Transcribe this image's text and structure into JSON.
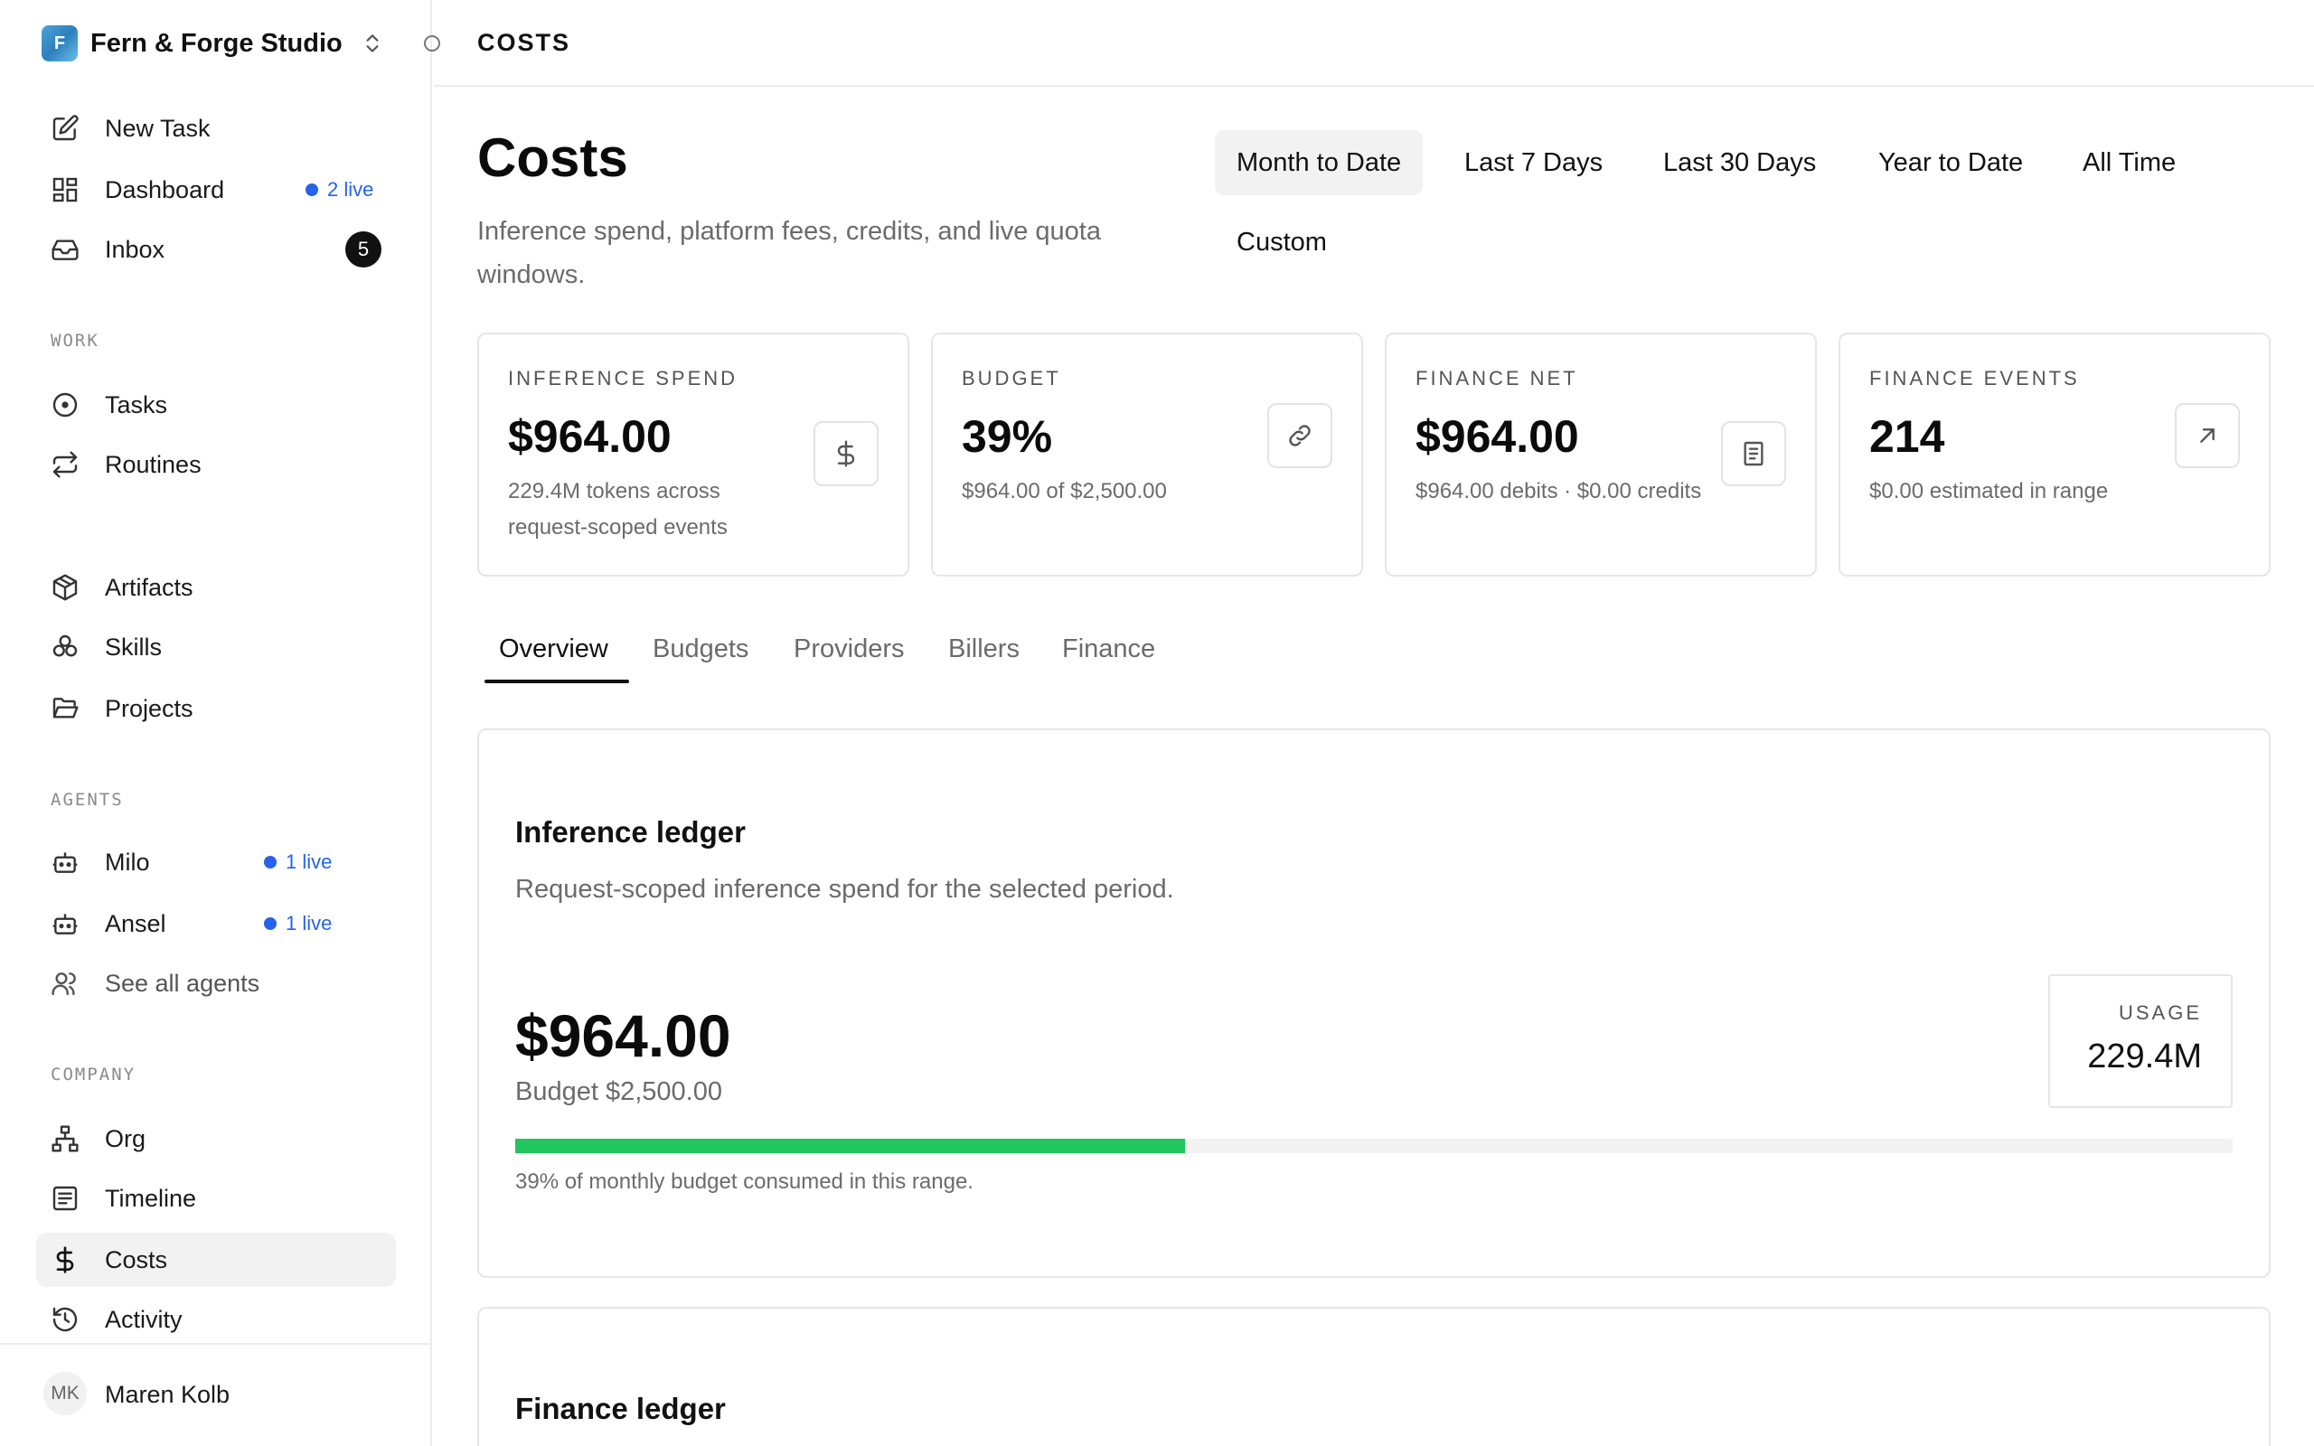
{
  "sidebar": {
    "company_name": "Fern & Forge Studio",
    "company_initial": "F",
    "items": {
      "new_task": "New Task",
      "dashboard": "Dashboard",
      "dashboard_live": "2 live",
      "inbox": "Inbox",
      "inbox_count": "5",
      "tasks": "Tasks",
      "routines": "Routines",
      "artifacts": "Artifacts",
      "skills": "Skills",
      "projects": "Projects",
      "milo": "Milo",
      "milo_live": "1 live",
      "ansel": "Ansel",
      "ansel_live": "1 live",
      "see_all_agents": "See all agents",
      "org": "Org",
      "timeline": "Timeline",
      "costs": "Costs",
      "activity": "Activity"
    },
    "sections": {
      "work": "WORK",
      "agents": "AGENTS",
      "company": "COMPANY"
    },
    "user": {
      "initials": "MK",
      "name": "Maren Kolb"
    }
  },
  "header": {
    "breadcrumb": "COSTS"
  },
  "page": {
    "title": "Costs",
    "subtitle": "Inference spend, platform fees, credits, and live quota windows."
  },
  "ranges": [
    "Month to Date",
    "Last 7 Days",
    "Last 30 Days",
    "Year to Date",
    "All Time",
    "Custom"
  ],
  "cards": [
    {
      "label": "INFERENCE SPEND",
      "value": "$964.00",
      "sub": "229.4M tokens across request-scoped events",
      "icon": "dollar-icon"
    },
    {
      "label": "BUDGET",
      "value": "39%",
      "sub": "$964.00 of $2,500.00",
      "icon": "link-icon"
    },
    {
      "label": "FINANCE NET",
      "value": "$964.00",
      "sub": "$964.00 debits · $0.00 credits",
      "icon": "receipt-icon"
    },
    {
      "label": "FINANCE EVENTS",
      "value": "214",
      "sub": "$0.00 estimated in range",
      "icon": "arrow-up-right-icon"
    }
  ],
  "tabs": [
    "Overview",
    "Budgets",
    "Providers",
    "Billers",
    "Finance"
  ],
  "inference_ledger": {
    "title": "Inference ledger",
    "subtitle": "Request-scoped inference spend for the selected period.",
    "amount": "$964.00",
    "budget": "Budget $2,500.00",
    "usage_label": "USAGE",
    "usage_value": "229.4M",
    "progress_fraction": 0.39,
    "progress_note": "39% of monthly budget consumed in this range."
  },
  "finance_ledger": {
    "title": "Finance ledger"
  },
  "colors": {
    "accent": "#22c55e",
    "live": "#2563eb"
  }
}
